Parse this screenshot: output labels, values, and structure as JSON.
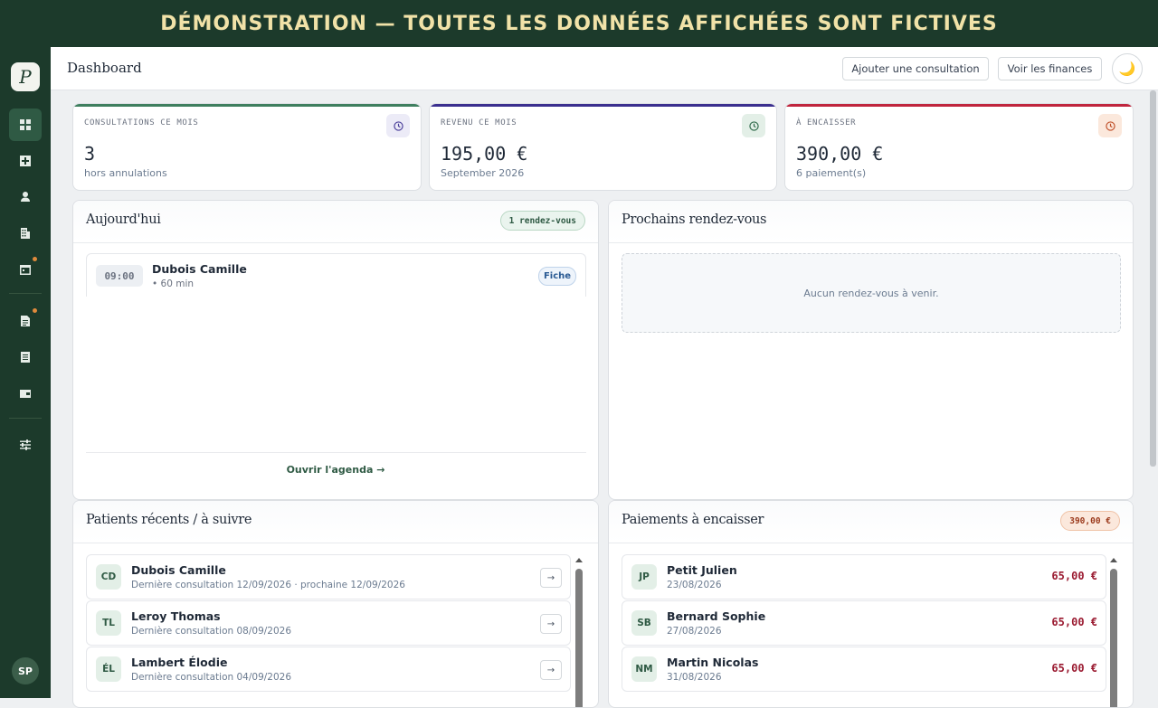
{
  "banner": "DÉMONSTRATION — TOUTES LES DONNÉES AFFICHÉES SONT FICTIVES",
  "sidebar": {
    "logo": "P",
    "items": [
      {
        "icon": "dashboard-grid-icon",
        "active": true,
        "badge": false
      },
      {
        "icon": "add-consultation-icon",
        "active": false,
        "badge": false
      },
      {
        "icon": "patient-user-icon",
        "active": false,
        "badge": false
      },
      {
        "icon": "building-icon",
        "active": false,
        "badge": false
      },
      {
        "icon": "calendar-icon",
        "active": false,
        "badge": true
      },
      {
        "icon": "document-icon",
        "active": false,
        "badge": true
      },
      {
        "icon": "invoice-icon",
        "active": false,
        "badge": false
      },
      {
        "icon": "wallet-icon",
        "active": false,
        "badge": false
      },
      {
        "icon": "settings-sliders-icon",
        "active": false,
        "badge": false
      }
    ],
    "user_initials": "SP"
  },
  "topbar": {
    "title": "Dashboard",
    "add_consultation": "Ajouter une consultation",
    "view_finances": "Voir les finances",
    "theme_icon": "moon-icon"
  },
  "stats": [
    {
      "label": "CONSULTATIONS CE MOIS",
      "value": "3",
      "sub": "hors annulations",
      "accent": "#3f7f5f",
      "icon_bg": "#ecebf7",
      "icon_color": "#4a3f9a"
    },
    {
      "label": "REVENU CE MOIS",
      "value": "195,00 €",
      "sub": "September 2026",
      "accent": "#3b2f8f",
      "icon_bg": "#e3efe7",
      "icon_color": "#2f6a4a"
    },
    {
      "label": "À ENCAISSER",
      "value": "390,00 €",
      "sub": "6 paiement(s)",
      "accent": "#c0253e",
      "icon_bg": "#fbe8dc",
      "icon_color": "#c0502a"
    }
  ],
  "today": {
    "title": "Aujourd'hui",
    "badge": "1 rendez-vous",
    "appointments": [
      {
        "time": "09:00",
        "name": "Dubois Camille",
        "meta": "• 60 min",
        "action": "Fiche"
      }
    ],
    "open_agenda": "Ouvrir l'agenda →"
  },
  "upcoming": {
    "title": "Prochains rendez-vous",
    "empty": "Aucun rendez-vous à venir."
  },
  "recent_patients": {
    "title": "Patients récents / à suivre",
    "rows": [
      {
        "initials": "CD",
        "name": "Dubois Camille",
        "sub": "Dernière consultation 12/09/2026 · prochaine 12/09/2026",
        "action": "→"
      },
      {
        "initials": "TL",
        "name": "Leroy Thomas",
        "sub": "Dernière consultation 08/09/2026",
        "action": "→"
      },
      {
        "initials": "ÉL",
        "name": "Lambert Élodie",
        "sub": "Dernière consultation 04/09/2026",
        "action": "→"
      }
    ]
  },
  "payments": {
    "title": "Paiements à encaisser",
    "badge": "390,00 €",
    "rows": [
      {
        "initials": "JP",
        "name": "Petit Julien",
        "date": "23/08/2026",
        "amount": "65,00 €"
      },
      {
        "initials": "SB",
        "name": "Bernard Sophie",
        "date": "27/08/2026",
        "amount": "65,00 €"
      },
      {
        "initials": "NM",
        "name": "Martin Nicolas",
        "date": "31/08/2026",
        "amount": "65,00 €"
      }
    ]
  }
}
